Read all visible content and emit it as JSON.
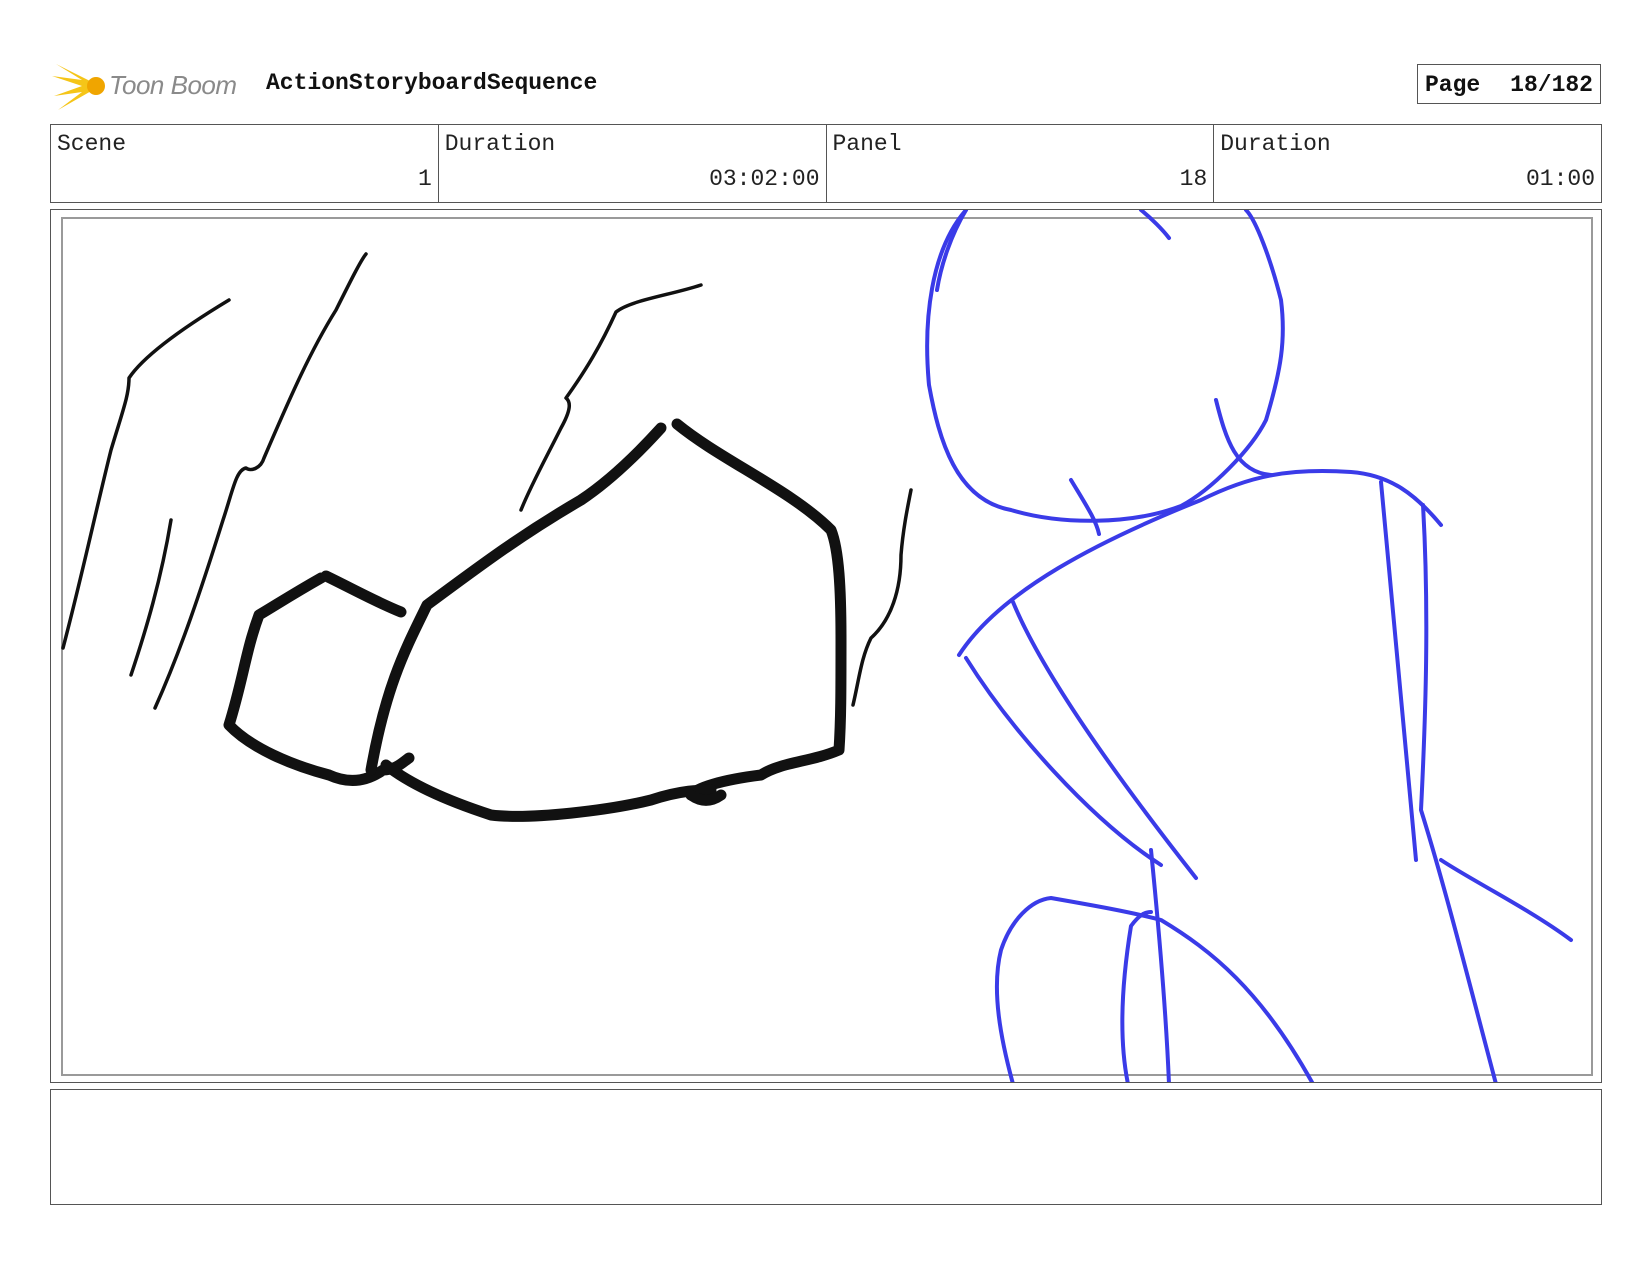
{
  "header": {
    "logo_text": "Toon Boom",
    "sequence_title": "ActionStoryboardSequence",
    "page_label": "Page",
    "page_number": "18/182"
  },
  "info": {
    "scene_label": "Scene",
    "scene_value": "1",
    "scene_duration_label": "Duration",
    "scene_duration_value": "03:02:00",
    "panel_label": "Panel",
    "panel_value": "18",
    "panel_duration_label": "Duration",
    "panel_duration_value": "01:00"
  },
  "sketch_colors": {
    "ink": "#111111",
    "figure": "#3a3be8",
    "logo_accent": "#f5c518"
  },
  "notes": ""
}
